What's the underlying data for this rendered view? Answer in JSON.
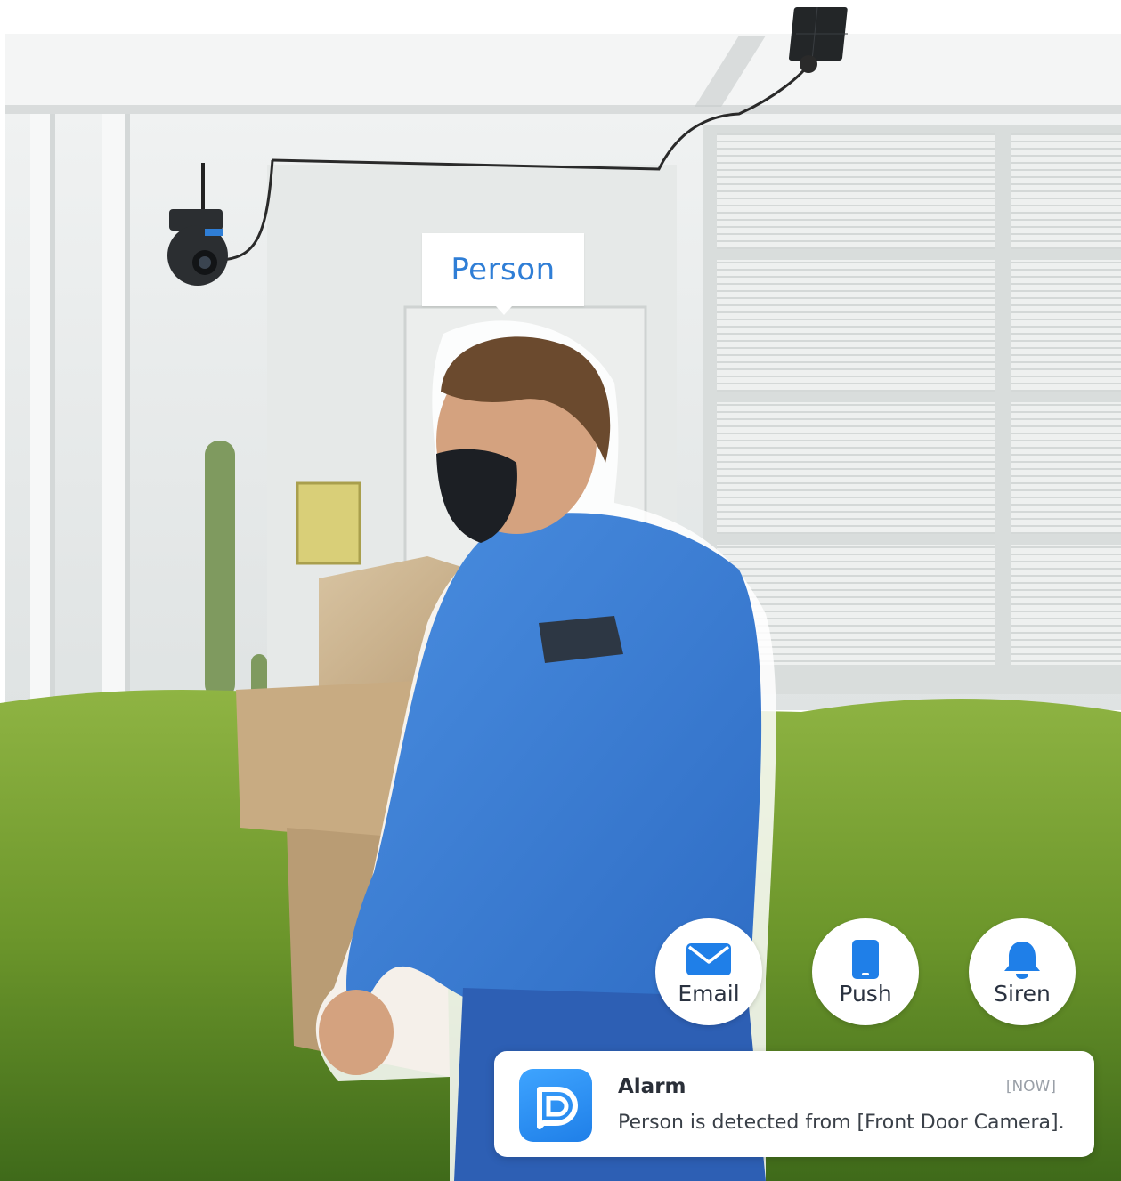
{
  "detection": {
    "label": "Person"
  },
  "actions": [
    {
      "label": "Email",
      "icon": "envelope-icon"
    },
    {
      "label": "Push",
      "icon": "phone-icon"
    },
    {
      "label": "Siren",
      "icon": "bell-icon"
    }
  ],
  "notification": {
    "title": "Alarm",
    "time": "[NOW]",
    "message": "Person is detected from [Front Door Camera].",
    "app_icon": "reolink-app-icon"
  },
  "colors": {
    "accent": "#2f7ed6",
    "icon_blue": "#1f7fe8",
    "hoodie": "#3b7fd6",
    "grass": "#6e9a2e",
    "wall": "#e9ecec"
  }
}
